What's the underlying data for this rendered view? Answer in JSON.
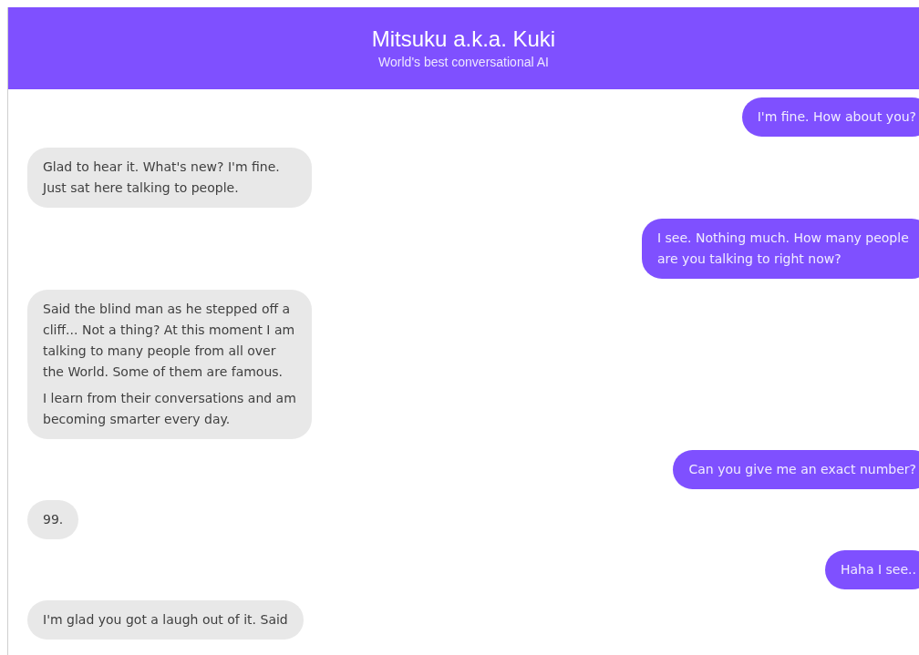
{
  "header": {
    "title": "Mitsuku a.k.a. Kuki",
    "subtitle": "World's best conversational AI"
  },
  "messages": [
    {
      "kind": "user",
      "paragraphs": [
        "I'm fine. How about you?"
      ]
    },
    {
      "kind": "bot",
      "paragraphs": [
        "Glad to hear it. What's new? I'm fine. Just sat here talking to people."
      ]
    },
    {
      "kind": "user",
      "paragraphs": [
        "I see. Nothing much. How many people are you talking to right now?"
      ]
    },
    {
      "kind": "bot",
      "paragraphs": [
        "Said the blind man as he stepped off a cliff... Not a thing? At this moment I am talking to many people from all over the World. Some of them are famous.",
        "I learn from their conversations and am becoming smarter every day."
      ]
    },
    {
      "kind": "user",
      "paragraphs": [
        "Can you give me an exact number?"
      ]
    },
    {
      "kind": "bot",
      "paragraphs": [
        "99."
      ]
    },
    {
      "kind": "user",
      "paragraphs": [
        "Haha I see.."
      ]
    },
    {
      "kind": "bot",
      "paragraphs": [
        "I'm glad you got a laugh out of it. Said"
      ]
    }
  ]
}
